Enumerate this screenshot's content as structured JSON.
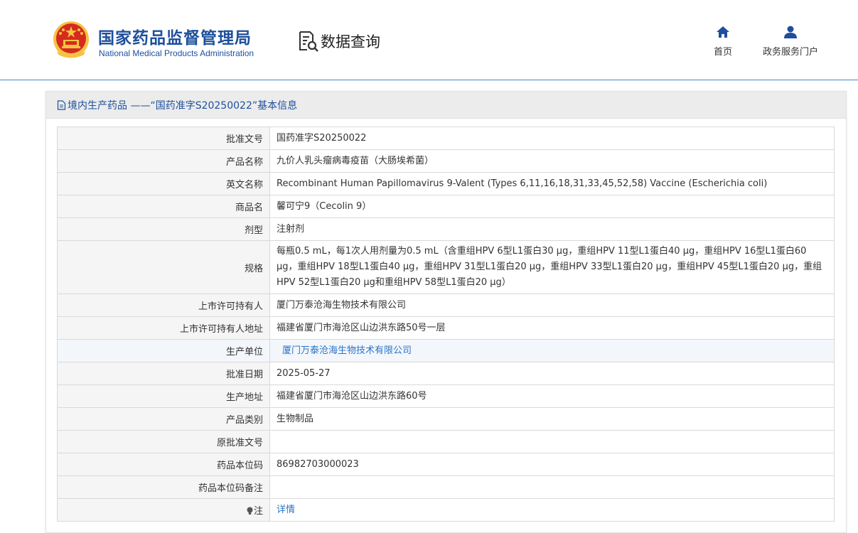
{
  "header": {
    "org_name_cn": "国家药品监督管理局",
    "org_name_en": "National Medical Products Administration",
    "query_title": "数据查询",
    "nav": [
      {
        "label": "首页",
        "icon": "home-icon"
      },
      {
        "label": "政务服务门户",
        "icon": "user-icon"
      }
    ]
  },
  "panel": {
    "title": "境内生产药品 ——“国药准字S20250022”基本信息"
  },
  "fields": [
    {
      "label": "批准文号",
      "value": "国药准字S20250022"
    },
    {
      "label": "产品名称",
      "value": "九价人乳头瘤病毒疫苗（大肠埃希菌）"
    },
    {
      "label": "英文名称",
      "value": "Recombinant Human Papillomavirus 9-Valent (Types 6,11,16,18,31,33,45,52,58) Vaccine (Escherichia coli)"
    },
    {
      "label": "商品名",
      "value": "馨可宁9（Cecolin 9）"
    },
    {
      "label": "剂型",
      "value": "注射剂"
    },
    {
      "label": "规格",
      "value": "每瓶0.5 mL，每1次人用剂量为0.5 mL（含重组HPV 6型L1蛋白30 μg，重组HPV 11型L1蛋白40 μg，重组HPV 16型L1蛋白60 μg，重组HPV 18型L1蛋白40 μg，重组HPV 31型L1蛋白20 μg，重组HPV 33型L1蛋白20 μg，重组HPV 45型L1蛋白20 μg，重组HPV 52型L1蛋白20 μg和重组HPV 58型L1蛋白20 μg）"
    },
    {
      "label": "上市许可持有人",
      "value": "厦门万泰沧海生物技术有限公司"
    },
    {
      "label": "上市许可持有人地址",
      "value": "福建省厦门市海沧区山边洪东路50号一层"
    },
    {
      "label": "生产单位",
      "value": "厦门万泰沧海生物技术有限公司"
    },
    {
      "label": "批准日期",
      "value": "2025-05-27"
    },
    {
      "label": "生产地址",
      "value": "福建省厦门市海沧区山边洪东路60号"
    },
    {
      "label": "产品类别",
      "value": "生物制品"
    },
    {
      "label": "原批准文号",
      "value": ""
    },
    {
      "label": "药品本位码",
      "value": "86982703000023"
    },
    {
      "label": "药品本位码备注",
      "value": ""
    },
    {
      "label": "注",
      "value": "详情"
    }
  ],
  "colors": {
    "brand_blue": "#1d4f9c",
    "link_blue": "#2a75c9",
    "emblem_red": "#d52b1e",
    "emblem_gold": "#f5c342"
  }
}
